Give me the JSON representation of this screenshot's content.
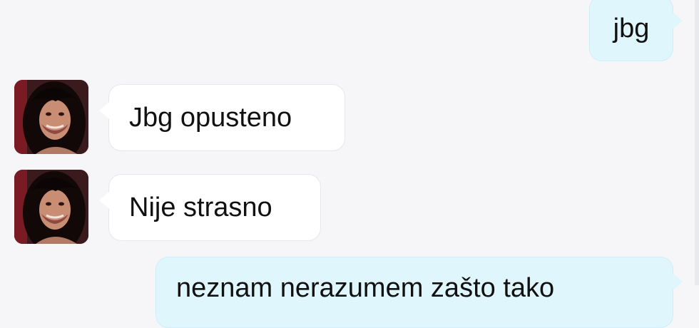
{
  "conversation": {
    "messages": [
      {
        "direction": "outgoing",
        "text": "jbg"
      },
      {
        "direction": "incoming",
        "text": "Jbg opusteno",
        "avatar_icon": "contact-avatar-photo"
      },
      {
        "direction": "incoming",
        "text": "Nije strasno",
        "avatar_icon": "contact-avatar-photo"
      },
      {
        "direction": "outgoing",
        "text": "neznam nerazumem zašto tako"
      }
    ]
  },
  "colors": {
    "background": "#f6f6f8",
    "outgoing_bubble": "#dff6fd",
    "incoming_bubble": "#ffffff"
  }
}
